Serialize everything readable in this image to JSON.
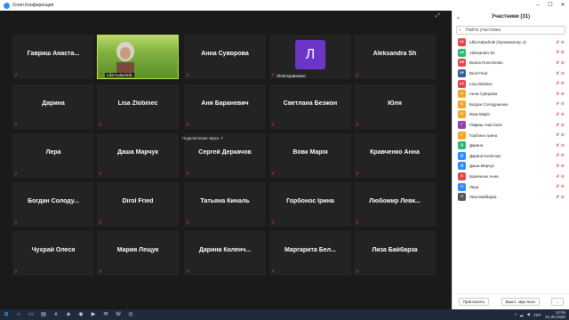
{
  "window": {
    "title": "Zoom Конференция"
  },
  "top_right_label": "⤢",
  "tiles": [
    {
      "name": "Гавриш Анаста..."
    },
    {
      "name": "",
      "overlay": "Lilia Kalachnik"
    },
    {
      "name": "Анна Суворова"
    },
    {
      "name": "",
      "avatar": "Л",
      "overlay": "Лілія Кравченко"
    },
    {
      "name": "Aleksandra Sh"
    },
    {
      "name": "Дарина"
    },
    {
      "name": "Lisa Zlobinec"
    },
    {
      "name": "Аня Бараневич"
    },
    {
      "name": "Светлана Безжон"
    },
    {
      "name": "Юля"
    },
    {
      "name": "Лера"
    },
    {
      "name": "Даша Марчук"
    },
    {
      "name": "Сергей Деркачов"
    },
    {
      "name": "Вовк Марія"
    },
    {
      "name": "Кравченко Анна"
    },
    {
      "name": "Богдан Солоду..."
    },
    {
      "name": "Dirol Fried"
    },
    {
      "name": "Татьяна Киналь"
    },
    {
      "name": "Горбонос Ірина"
    },
    {
      "name": "Любомир Левк..."
    },
    {
      "name": "Чухрай Олеся"
    },
    {
      "name": "Мария Лещук"
    },
    {
      "name": "Дарина Коленч..."
    },
    {
      "name": "Маргарита Бел..."
    },
    {
      "name": "Лиза Байбарза"
    }
  ],
  "connecting_audio": "Подключение звука ↗",
  "panel": {
    "title": "Участники (31)",
    "collapse": "⌄",
    "search_placeholder": "Найти участника",
    "participants": [
      {
        "initials": "LK",
        "name": "Lillia Kalachnik (Организатор, я)",
        "color": "#e0474c"
      },
      {
        "initials": "AS",
        "name": "Aleksandra Sh",
        "color": "#2bb673"
      },
      {
        "initials": "DR",
        "name": "Darina Romchenko",
        "color": "#e0474c"
      },
      {
        "initials": "DF",
        "name": "Dirol Fried",
        "color": "#3b5998"
      },
      {
        "initials": "LZ",
        "name": "Lisa Zlobinec",
        "color": "#e0474c"
      },
      {
        "initials": "А",
        "name": "Анна Суворова",
        "color": "#f5a623"
      },
      {
        "initials": "Б",
        "name": "Богдан Солодушенко",
        "color": "#f5a623"
      },
      {
        "initials": "В",
        "name": "Вовк Марія",
        "color": "#f5a623"
      },
      {
        "initials": "Г",
        "name": "Гавриш Анастасія",
        "color": "#8e44ad"
      },
      {
        "initials": "Г",
        "name": "Горбонос Ірина",
        "color": "#f5a623"
      },
      {
        "initials": "Д",
        "name": "Дарина",
        "color": "#2bb673"
      },
      {
        "initials": "Д",
        "name": "Дарина Коленчук",
        "color": "#2d8cff"
      },
      {
        "initials": "Д",
        "name": "Даша Марчук",
        "color": "#2d8cff"
      },
      {
        "initials": "К",
        "name": "Кравченко Анна",
        "color": "#e0474c"
      },
      {
        "initials": "Л",
        "name": "Лера",
        "color": "#2d8cff"
      },
      {
        "initials": "Л",
        "name": "Лиза Байбарза",
        "color": "#555555"
      }
    ],
    "invite": "Пригласить",
    "mute_all": "Выкл. звук всех",
    "more": "..."
  },
  "taskbar": {
    "icons": [
      "windows-logo",
      "search",
      "task-view",
      "explorer",
      "edge",
      "store",
      "chrome",
      "video",
      "mail",
      "word",
      "zoom"
    ],
    "tray_lang": "УКР",
    "time": "10:06",
    "date": "01.06.2020"
  },
  "colors": {
    "mic_muted": "#e02828",
    "video_border": "#b8e03a"
  }
}
